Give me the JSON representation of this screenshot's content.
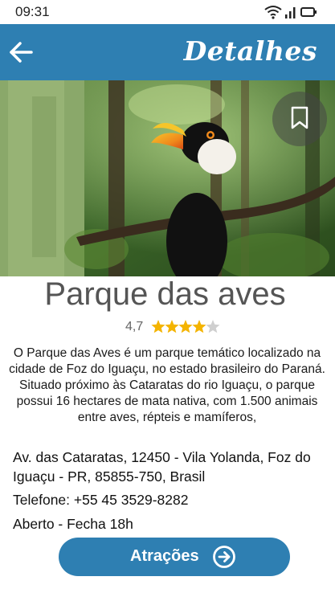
{
  "status_bar": {
    "time": "09:31"
  },
  "app_bar": {
    "title": "Detalhes"
  },
  "place": {
    "name": "Parque das aves",
    "rating": "4,7",
    "rating_value": 4.7,
    "rating_max": 5,
    "description": "O Parque das Aves é um parque temático localizado na cidade de Foz do Iguaçu, no estado brasileiro do Paraná. Situado próximo às Cataratas do rio Iguaçu, o parque possui 16 hectares de mata nativa, com 1.500 animais entre aves, répteis e mamíferos,",
    "address": "Av. das Cataratas, 12450 - Vila Yolanda, Foz do Iguaçu - PR, 85855-750, Brasil",
    "phone": "Telefone: +55 45 3529-8282",
    "hours": "Aberto - Fecha 18h"
  },
  "actions": {
    "attractions_label": "Atrações"
  },
  "icons": {
    "back": "arrow-left-icon",
    "bookmark": "bookmark-icon",
    "cta": "arrow-right-circle-icon"
  },
  "colors": {
    "primary": "#2e7fb2",
    "star": "#f4b400",
    "title_text": "#555555"
  }
}
